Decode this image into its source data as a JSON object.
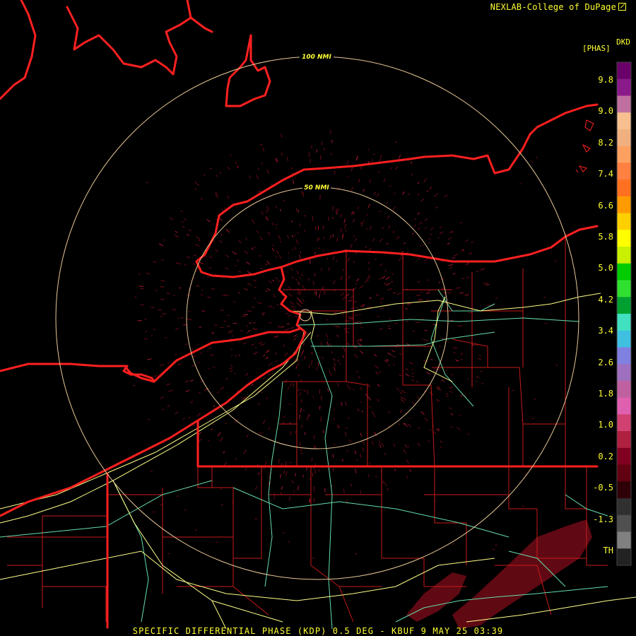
{
  "credit": "NEXLAB-College of DuPage",
  "credit_icon": "external-link-icon",
  "product_code": "DKD",
  "unit_label": "[PHAS]",
  "range_rings": [
    {
      "label": "50 NMI",
      "radius_nmi": 50
    },
    {
      "label": "100 NMI",
      "radius_nmi": 100
    }
  ],
  "colorbar_ticks": [
    "9.8",
    "9.0",
    "8.2",
    "7.4",
    "6.6",
    "5.8",
    "5.0",
    "4.2",
    "3.4",
    "2.6",
    "1.8",
    "1.0",
    "0.2",
    "-0.5",
    "-1.3",
    "TH"
  ],
  "colorbar_colors": [
    "#6a006a",
    "#8a1a8a",
    "#c070a0",
    "#f8c090",
    "#f0b080",
    "#ffa060",
    "#ff8040",
    "#ff7020",
    "#ff9a00",
    "#ffd000",
    "#ffff00",
    "#c8f000",
    "#00cc00",
    "#30e030",
    "#00a030",
    "#40e0c0",
    "#40c0e0",
    "#8080e0",
    "#a070c0",
    "#c060a0",
    "#e060b0",
    "#d04070",
    "#b02040",
    "#800020",
    "#600010",
    "#300008",
    "#303030",
    "#505050",
    "#808080",
    "#222222"
  ],
  "footer": "SPECIFIC DIFFERENTIAL PHASE (KDP) 0.5 DEG - KBUF 9 MAY 25 03:39",
  "colors": {
    "state_border": "#ff2020",
    "county_border": "#d01818",
    "interstate": "#ffff88",
    "highway": "#66ddaa",
    "range_ring": "#e8c896",
    "text": "#ffff33",
    "echo": "#8a1020"
  }
}
